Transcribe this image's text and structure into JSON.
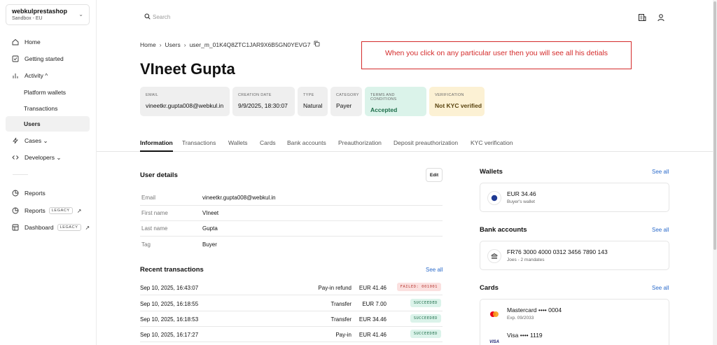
{
  "workspace": {
    "name": "webkulprestashop",
    "env": "Sandbox - EU"
  },
  "sidebar": {
    "items": [
      {
        "label": "Home",
        "icon": "home-icon"
      },
      {
        "label": "Getting started",
        "icon": "checkbox-icon"
      },
      {
        "label": "Activity ^",
        "icon": "bar-chart-icon"
      },
      {
        "label": "Platform wallets"
      },
      {
        "label": "Transactions"
      },
      {
        "label": "Users"
      },
      {
        "label": "Cases ⌄",
        "icon": "bolt-icon"
      },
      {
        "label": "Developers ⌄",
        "icon": "code-icon"
      },
      {
        "label": "Reports",
        "icon": "pie-icon"
      },
      {
        "label": "Reports",
        "icon": "pie-icon",
        "tag": "LEGACY"
      },
      {
        "label": "Dashboard",
        "icon": "dashboard-icon",
        "tag": "LEGACY"
      }
    ]
  },
  "search": {
    "placeholder": "Search"
  },
  "breadcrumb": {
    "home": "Home",
    "users": "Users",
    "current": "user_m_01K4Q8ZTC1JAR9X6B5GN0YEVG7"
  },
  "page_title": "VIneet Gupta",
  "callout": "When you click on any particular user then you will see all his detials",
  "info_cards": [
    {
      "label": "EMAIL",
      "value": "vineetkr.gupta008@webkul.in"
    },
    {
      "label": "CREATION DATE",
      "value": "9/9/2025, 18:30:07"
    },
    {
      "label": "TYPE",
      "value": "Natural"
    },
    {
      "label": "CATEGORY",
      "value": "Payer"
    },
    {
      "label": "TERMS AND CONDITIONS",
      "value": "Accepted"
    },
    {
      "label": "VERIFICATION",
      "value": "Not KYC verified"
    }
  ],
  "tabs": [
    "Information",
    "Transactions",
    "Wallets",
    "Cards",
    "Bank accounts",
    "Preauthorization",
    "Deposit preauthorization",
    "KYC verification"
  ],
  "user_details": {
    "title": "User details",
    "edit": "Edit",
    "rows": [
      {
        "key": "Email",
        "value": "vineetkr.gupta008@webkul.in"
      },
      {
        "key": "First name",
        "value": "VIneet"
      },
      {
        "key": "Last name",
        "value": "Gupta"
      },
      {
        "key": "Tag",
        "value": "Buyer"
      }
    ]
  },
  "recent": {
    "title": "Recent transactions",
    "see_all": "See all",
    "rows": [
      {
        "date": "Sep 10, 2025, 16:43:07",
        "type": "Pay-in refund",
        "amount": "EUR 41.46",
        "status": "FAILED: 001001"
      },
      {
        "date": "Sep 10, 2025, 16:18:55",
        "type": "Transfer",
        "amount": "EUR 7.00",
        "status": "SUCCEEDED"
      },
      {
        "date": "Sep 10, 2025, 16:18:53",
        "type": "Transfer",
        "amount": "EUR 34.46",
        "status": "SUCCEEDED"
      },
      {
        "date": "Sep 10, 2025, 16:17:27",
        "type": "Pay-in",
        "amount": "EUR 41.46",
        "status": "SUCCEEDED"
      }
    ]
  },
  "wallets": {
    "title": "Wallets",
    "see_all": "See all",
    "item": {
      "title": "EUR 34.46",
      "sub": "Buyer's wallet"
    }
  },
  "bank_accounts": {
    "title": "Bank accounts",
    "see_all": "See all",
    "item": {
      "title": "FR76 3000 4000 0312 3456 7890 143",
      "sub": "Joes - 2 mandates"
    }
  },
  "cards": {
    "title": "Cards",
    "see_all": "See all",
    "items": [
      {
        "title": "Mastercard •••• 0004",
        "sub": "Exp. 09/2033",
        "brand": "mastercard"
      },
      {
        "title": "Visa •••• 1119",
        "sub": "",
        "brand": "VISA"
      }
    ]
  },
  "colors": {
    "accent_link": "#2d6ccb",
    "success_bg": "#dbf3ea",
    "fail_bg": "#fbe0df",
    "warning_bg": "#fcf1d4",
    "callout": "#d42b2b"
  }
}
